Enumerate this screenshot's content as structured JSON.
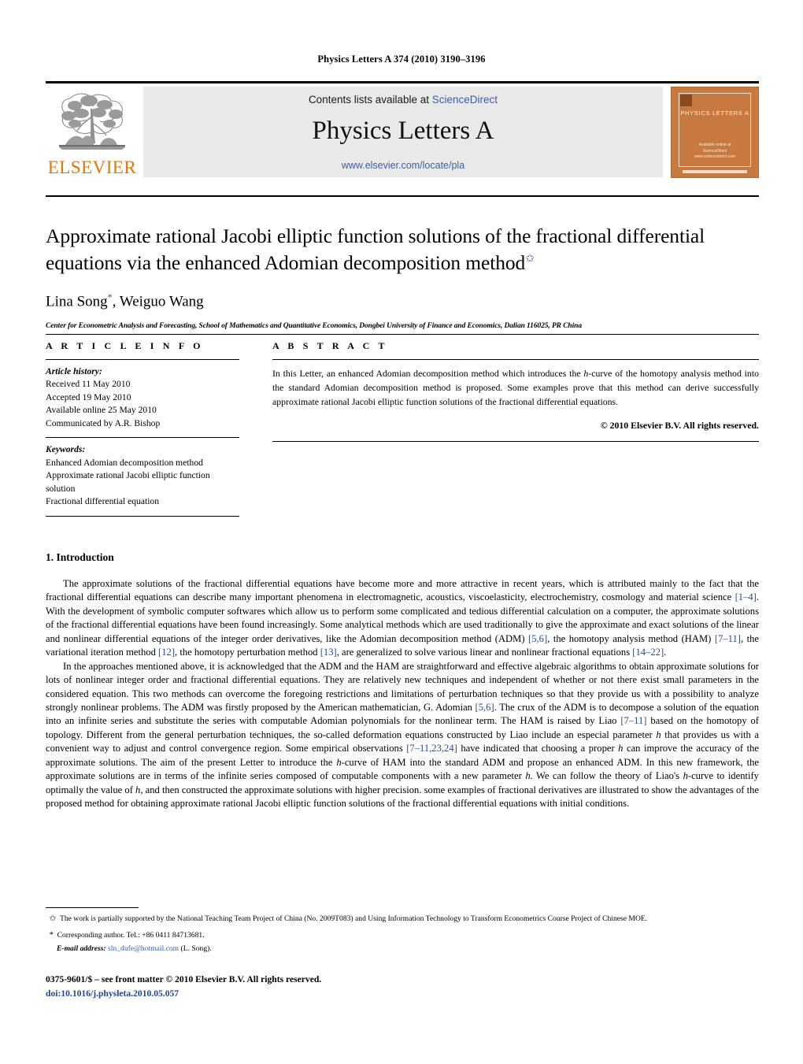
{
  "running_head": "Physics Letters A 374 (2010) 3190–3196",
  "masthead": {
    "contents_prefix": "Contents lists available at ",
    "sciencedirect": "ScienceDirect",
    "journal_title": "Physics Letters A",
    "journal_url": "www.elsevier.com/locate/pla",
    "publisher_logo_text": "ELSEVIER",
    "cover": {
      "title": "PHYSICS LETTERS A",
      "footer_line1": "Available online at",
      "footer_line2": "ScienceDirect",
      "footer_line3": "www.sciencedirect.com"
    },
    "accent_color": "#3a5fa8",
    "elsevier_orange": "#e77500",
    "cover_color": "#c8793f"
  },
  "article": {
    "title": "Approximate rational Jacobi elliptic function solutions of the fractional differential equations via the enhanced Adomian decomposition method",
    "title_footnote_mark": "✩",
    "authors": "Lina Song",
    "author_mark": "*",
    "authors_rest": ", Weiguo Wang",
    "affiliation": "Center for Econometric Analysis and Forecasting, School of Mathematics and Quantitative Economics, Dongbei University of Finance and Economics, Dalian 116025, PR China"
  },
  "article_info": {
    "heading": "A R T I C L E    I N F O",
    "history_label": "Article history:",
    "history": [
      "Received 11 May 2010",
      "Accepted 19 May 2010",
      "Available online 25 May 2010",
      "Communicated by A.R. Bishop"
    ],
    "keywords_label": "Keywords:",
    "keywords": [
      "Enhanced Adomian decomposition method",
      "Approximate rational Jacobi elliptic function solution",
      "Fractional differential equation"
    ]
  },
  "abstract": {
    "heading": "A B S T R A C T",
    "text_part1": "In this Letter, an enhanced Adomian decomposition method which introduces the ",
    "h_italic": "h",
    "text_part2": "-curve of the homotopy analysis method into the standard Adomian decomposition method is proposed. Some examples prove that this method can derive successfully approximate rational Jacobi elliptic function solutions of the fractional differential equations.",
    "copyright": "© 2010 Elsevier B.V. All rights reserved."
  },
  "introduction": {
    "section_title": "1. Introduction",
    "p1_a": "The approximate solutions of the fractional differential equations have become more and more attractive in recent years, which is attributed mainly to the fact that the fractional differential equations can describe many important phenomena in electromagnetic, acoustics, viscoelasticity, electrochemistry, cosmology and material science ",
    "p1_c1": "[1–4]",
    "p1_b": ". With the development of symbolic computer softwares which allow us to perform some complicated and tedious differential calculation on a computer, the approximate solutions of the fractional differential equations have been found increasingly. Some analytical methods which are used traditionally to give the approximate and exact solutions of the linear and nonlinear differential equations of the integer order derivatives, like the Adomian decomposition method (ADM) ",
    "p1_c2": "[5,6]",
    "p1_d": ", the homotopy analysis method (HAM) ",
    "p1_c3": "[7–11]",
    "p1_e": ", the variational iteration method ",
    "p1_c4": "[12]",
    "p1_f": ", the homotopy perturbation method ",
    "p1_c5": "[13]",
    "p1_g": ", are generalized to solve various linear and nonlinear fractional equations ",
    "p1_c6": "[14–22]",
    "p1_h": ".",
    "p2_a": "In the approaches mentioned above, it is acknowledged that the ADM and the HAM are straightforward and effective algebraic algorithms to obtain approximate solutions for lots of nonlinear integer order and fractional differential equations. They are relatively new techniques and independent of whether or not there exist small parameters in the considered equation. This two methods can overcome the foregoing restrictions and limitations of perturbation techniques so that they provide us with a possibility to analyze strongly nonlinear problems. The ADM was firstly proposed by the American mathematician, G. Adomian ",
    "p2_c1": "[5,6]",
    "p2_b": ". The crux of the ADM is to decompose a solution of the equation into an infinite series and substitute the series with computable Adomian polynomials for the nonlinear term. The HAM is raised by Liao ",
    "p2_c2": "[7–11]",
    "p2_c": " based on the homotopy of topology. Different from the general perturbation techniques, the so-called deformation equations constructed by Liao include an especial parameter ",
    "p2_h1": "h",
    "p2_d": " that provides us with a convenient way to adjust and control convergence region. Some empirical observations ",
    "p2_c3": "[7–11,23,24]",
    "p2_e": " have indicated that choosing a proper ",
    "p2_h2": "h",
    "p2_f": " can improve the accuracy of the approximate solutions. The aim of the present Letter to introduce the ",
    "p2_h3": "h",
    "p2_g": "-curve of HAM into the standard ADM and propose an enhanced ADM. In this new framework, the approximate solutions are in terms of the infinite series composed of computable components with a new parameter ",
    "p2_h4": "h",
    "p2_i": ". We can follow the theory of Liao's ",
    "p2_h5": "h",
    "p2_j": "-curve to identify optimally the value of ",
    "p2_h6": "h",
    "p2_k": ", and then constructed the approximate solutions with higher precision. some examples of fractional derivatives are illustrated to show the advantages of the proposed method for obtaining approximate rational Jacobi elliptic function solutions of the fractional differential equations with initial conditions."
  },
  "footnotes": {
    "fn_star_mark": "✩",
    "fn_star_text": "The work is partially supported by the National Teaching Team Project of China (No. 2009T083) and Using Information Technology to Transform Econometrics Course Project of Chinese MOE.",
    "fn_corr_mark": "*",
    "fn_corr_text": "Corresponding author. Tel.: +86 0411 84713681.",
    "fn_email_label": "E-mail address:",
    "fn_email": "sln_dufe@hotmail.com",
    "fn_email_suffix": " (L. Song)."
  },
  "imprint": {
    "line1": "0375-9601/$ – see front matter © 2010 Elsevier B.V. All rights reserved.",
    "doi": "doi:10.1016/j.physleta.2010.05.057"
  }
}
